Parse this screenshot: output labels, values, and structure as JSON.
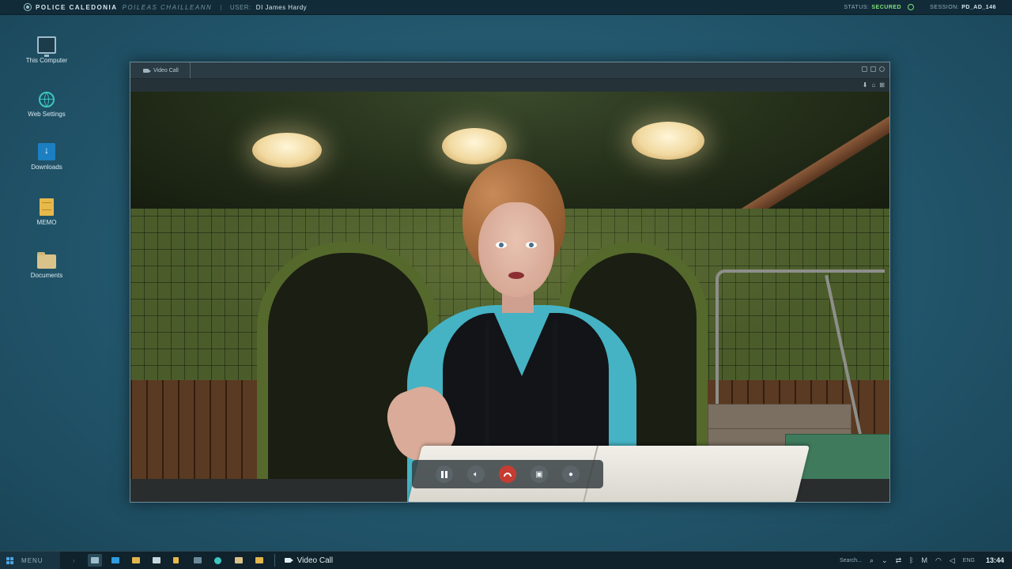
{
  "topbar": {
    "org_name": "POLICE CALEDONIA",
    "org_name_gaelic": "POILEAS CHAILLEANN",
    "separator": "|",
    "user_label": "USER:",
    "user_name": "DI James Hardy",
    "status_label": "STATUS:",
    "status_value": "SECURED",
    "session_label": "SESSION:",
    "session_value": "PD_AD_146"
  },
  "desktop": {
    "icons": [
      {
        "label": "This Computer",
        "icon": "monitor-icon"
      },
      {
        "label": "Web Settings",
        "icon": "globe-icon"
      },
      {
        "label": "Downloads",
        "icon": "download-icon"
      },
      {
        "label": "MEMO",
        "icon": "memo-icon"
      },
      {
        "label": "Documents",
        "icon": "folder-icon"
      }
    ]
  },
  "window": {
    "tab_title": "Video Call",
    "tab_icon": "camera-icon",
    "toolbar_icons": [
      "download-icon",
      "home-icon",
      "expand-icon"
    ]
  },
  "call_controls": {
    "buttons": [
      "pause-button",
      "volume-button",
      "end-call-button",
      "camera-off-button",
      "microphone-button"
    ],
    "end_call_color": "#c63c32"
  },
  "taskbar": {
    "start_label": "MENU",
    "active_app": "Video Call",
    "search_label": "Search...",
    "language": "ENG",
    "clock": "13:44"
  },
  "colors": {
    "accent": "#1b7fc2",
    "status_ok": "#7fe07a",
    "desktop_bg": "#245a70"
  }
}
